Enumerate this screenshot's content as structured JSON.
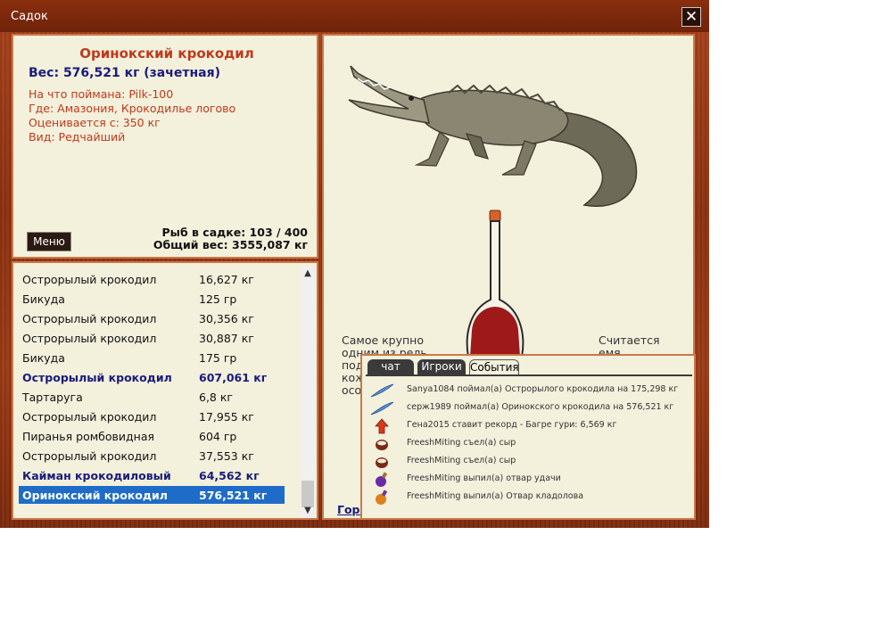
{
  "window": {
    "title": "Садок",
    "close_label": "✕"
  },
  "fish_info": {
    "name": "Оринокский крокодил",
    "weight_line": "Вес: 576,521 кг (зачетная)",
    "details": [
      "На что поймана: Pilk-100",
      "Где: Амазония, Крокодилье логово",
      "Оценивается с: 350 кг",
      "Вид: Редчайший"
    ],
    "menu_label": "Меню",
    "fish_count": "Рыб в садке: 103 / 400",
    "total_weight": "Общий вес: 3555,087 кг"
  },
  "fish_list": [
    {
      "name": "Острорылый крокодил",
      "weight": "16,627 кг",
      "style": "normal"
    },
    {
      "name": "Бикуда",
      "weight": "125 гр",
      "style": "normal"
    },
    {
      "name": "Острорылый крокодил",
      "weight": "30,356 кг",
      "style": "normal"
    },
    {
      "name": "Острорылый крокодил",
      "weight": "30,887 кг",
      "style": "normal"
    },
    {
      "name": "Бикуда",
      "weight": "175 гр",
      "style": "normal"
    },
    {
      "name": "Острорылый крокодил",
      "weight": "607,061 кг",
      "style": "bold"
    },
    {
      "name": "Тартаруга",
      "weight": "6,8 кг",
      "style": "normal"
    },
    {
      "name": "Острорылый крокодил",
      "weight": "17,955 кг",
      "style": "normal"
    },
    {
      "name": "Пиранья ромбовидная",
      "weight": "604 гр",
      "style": "normal"
    },
    {
      "name": "Острорылый крокодил",
      "weight": "37,553 кг",
      "style": "normal"
    },
    {
      "name": "Кайман крокодиловый",
      "weight": "64,562 кг",
      "style": "bold"
    },
    {
      "name": "Оринокский крокодил",
      "weight": "576,521 кг",
      "style": "selected"
    }
  ],
  "description": {
    "col1": [
      "Самое крупно",
      "одним из рель",
      "под",
      "кож",
      "осо"
    ],
    "col2": [
      "Считается",
      "емя"
    ],
    "link": "Горя"
  },
  "chat": {
    "tabs": [
      "чат",
      "Игроки",
      "События"
    ],
    "active_tab": "События",
    "events": [
      {
        "icon": "feather-icon",
        "text": "Sanya1084 поймал(а) Острорылого крокодила на 175,298 кг"
      },
      {
        "icon": "feather-icon",
        "text": "серж1989 поймал(а) Оринокского крокодила на 576,521 кг"
      },
      {
        "icon": "record-arrow-icon",
        "text": "Гена2015 ставит рекорд - Багре гури: 6,569 кг"
      },
      {
        "icon": "food-bowl-icon",
        "text": "FreeshMiting съел(а) сыр"
      },
      {
        "icon": "food-bowl-icon",
        "text": "FreeshMiting съел(а) сыр"
      },
      {
        "icon": "purple-potion-icon",
        "text": "FreeshMiting выпил(а) отвар удачи"
      },
      {
        "icon": "orange-potion-icon",
        "text": "FreeshMiting выпил(а) Отвар кладолова"
      }
    ]
  },
  "colors": {
    "accent_red": "#c0391b",
    "accent_blue": "#1a1c7a",
    "selection": "#1e6cc8",
    "frame": "#9b3a15"
  }
}
